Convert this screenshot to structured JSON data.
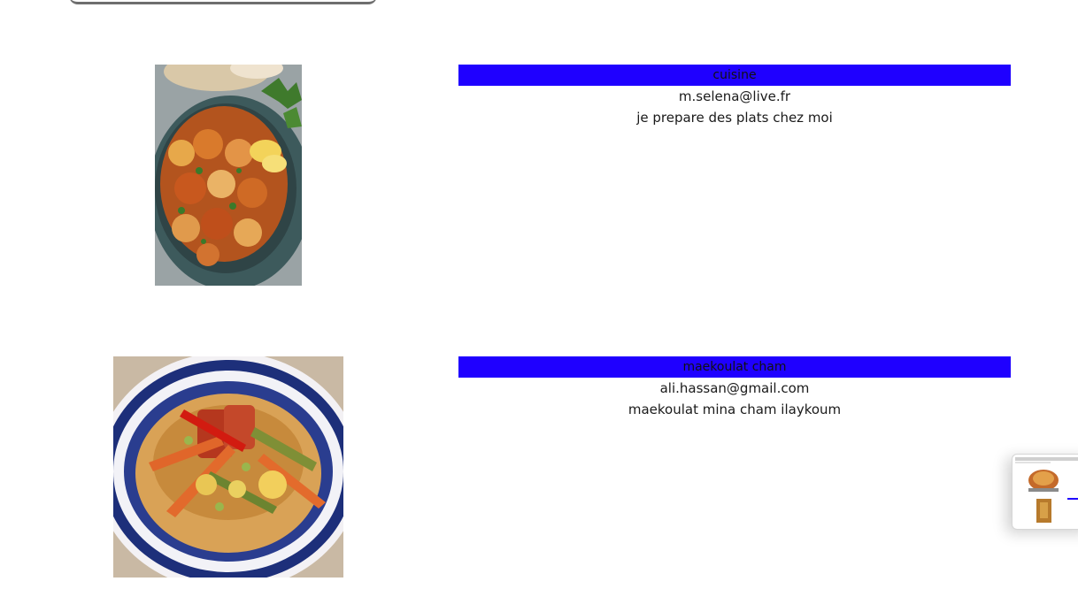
{
  "posts": [
    {
      "title": "cuisine",
      "email": "m.selena@live.fr",
      "description": "je prepare des plats chez moi",
      "image_alt": "cauliflower dish with lemon and parsley"
    },
    {
      "title": "maekoulat cham",
      "email": "ali.hassan@gmail.com",
      "description": "maekoulat mina cham ilaykoum",
      "image_alt": "couscous with vegetables"
    }
  ],
  "colors": {
    "title_bar": "#1f00ff",
    "background": "#ffffff"
  }
}
